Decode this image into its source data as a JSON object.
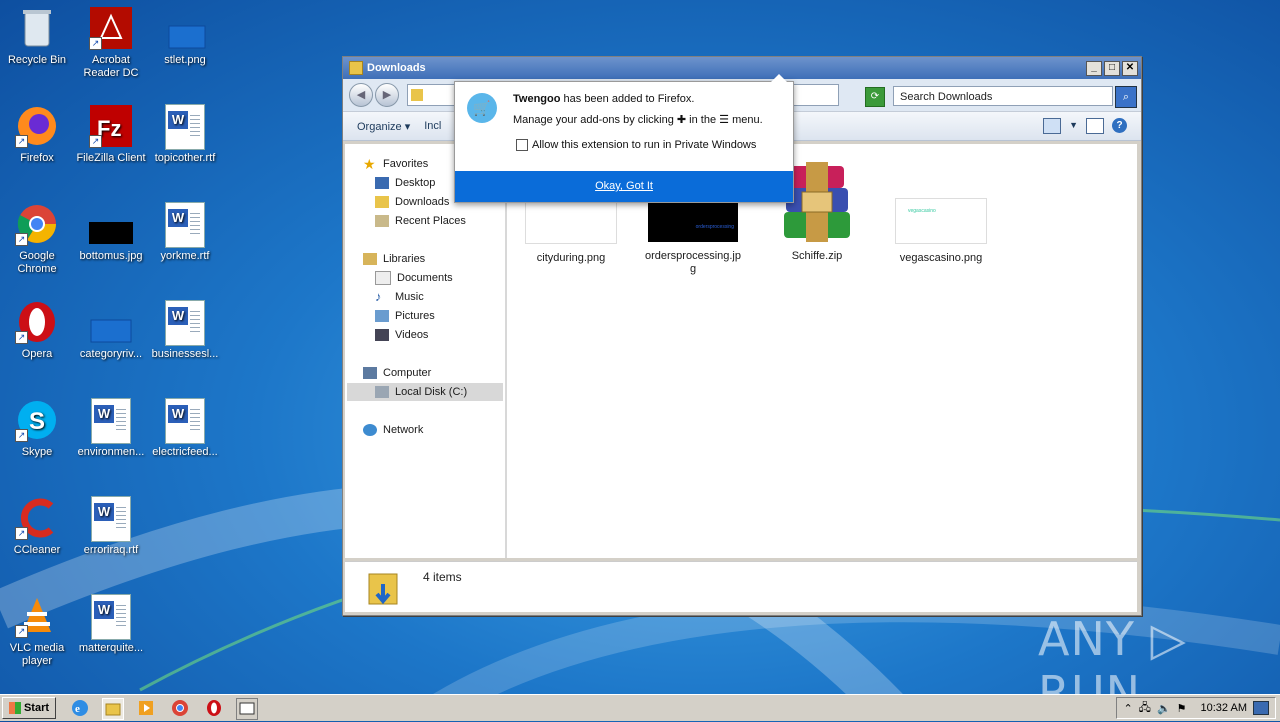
{
  "desktop": {
    "icons": [
      {
        "label": "Recycle Bin",
        "icon": "recycle-bin-icon"
      },
      {
        "label": "Acrobat Reader DC",
        "icon": "acrobat-icon"
      },
      {
        "label": "stlet.png",
        "icon": "image-file-icon"
      },
      {
        "label": "Firefox",
        "icon": "firefox-icon"
      },
      {
        "label": "FileZilla Client",
        "icon": "filezilla-icon"
      },
      {
        "label": "topicother.rtf",
        "icon": "word-doc-icon"
      },
      {
        "label": "Google Chrome",
        "icon": "chrome-icon"
      },
      {
        "label": "bottomus.jpg",
        "icon": "image-file-icon"
      },
      {
        "label": "yorkme.rtf",
        "icon": "word-doc-icon"
      },
      {
        "label": "Opera",
        "icon": "opera-icon"
      },
      {
        "label": "categoryriv...",
        "icon": "image-file-icon"
      },
      {
        "label": "businessesl...",
        "icon": "word-doc-icon"
      },
      {
        "label": "Skype",
        "icon": "skype-icon"
      },
      {
        "label": "environmen...",
        "icon": "word-doc-icon"
      },
      {
        "label": "electricfeed...",
        "icon": "word-doc-icon"
      },
      {
        "label": "CCleaner",
        "icon": "ccleaner-icon"
      },
      {
        "label": "erroriraq.rtf",
        "icon": "word-doc-icon"
      },
      {
        "label": "VLC media player",
        "icon": "vlc-icon"
      },
      {
        "label": "matterquite...",
        "icon": "word-doc-icon"
      }
    ]
  },
  "explorer": {
    "title": "Downloads",
    "search_placeholder": "Search Downloads",
    "toolbar": {
      "organize": "Organize ▾",
      "include": "Incl"
    },
    "nav": {
      "favorites": "Favorites",
      "desktop": "Desktop",
      "downloads": "Downloads",
      "recent": "Recent Places",
      "libraries": "Libraries",
      "documents": "Documents",
      "music": "Music",
      "pictures": "Pictures",
      "videos": "Videos",
      "computer": "Computer",
      "local_disk": "Local Disk (C:)",
      "network": "Network"
    },
    "files": [
      {
        "name": "cityduring.png"
      },
      {
        "name": "ordersprocessing.jp g"
      },
      {
        "name": "Schiffe.zip"
      },
      {
        "name": "vegascasino.png"
      }
    ],
    "thumb_text": {
      "orders": "ordersprocessing",
      "vegas": "vegascasino"
    },
    "status": "4 items"
  },
  "popup": {
    "ext_name": "Twengoo",
    "added_text": " has been added to Firefox.",
    "manage_pre": "Manage your add-ons by clicking",
    "manage_mid": "in the",
    "manage_post": "menu.",
    "private_label": "Allow this extension to run in Private Windows",
    "ok_label": "Okay, Got It"
  },
  "taskbar": {
    "start_label": "Start",
    "clock": "10:32 AM"
  },
  "watermark": "ANY ▷ RUN"
}
